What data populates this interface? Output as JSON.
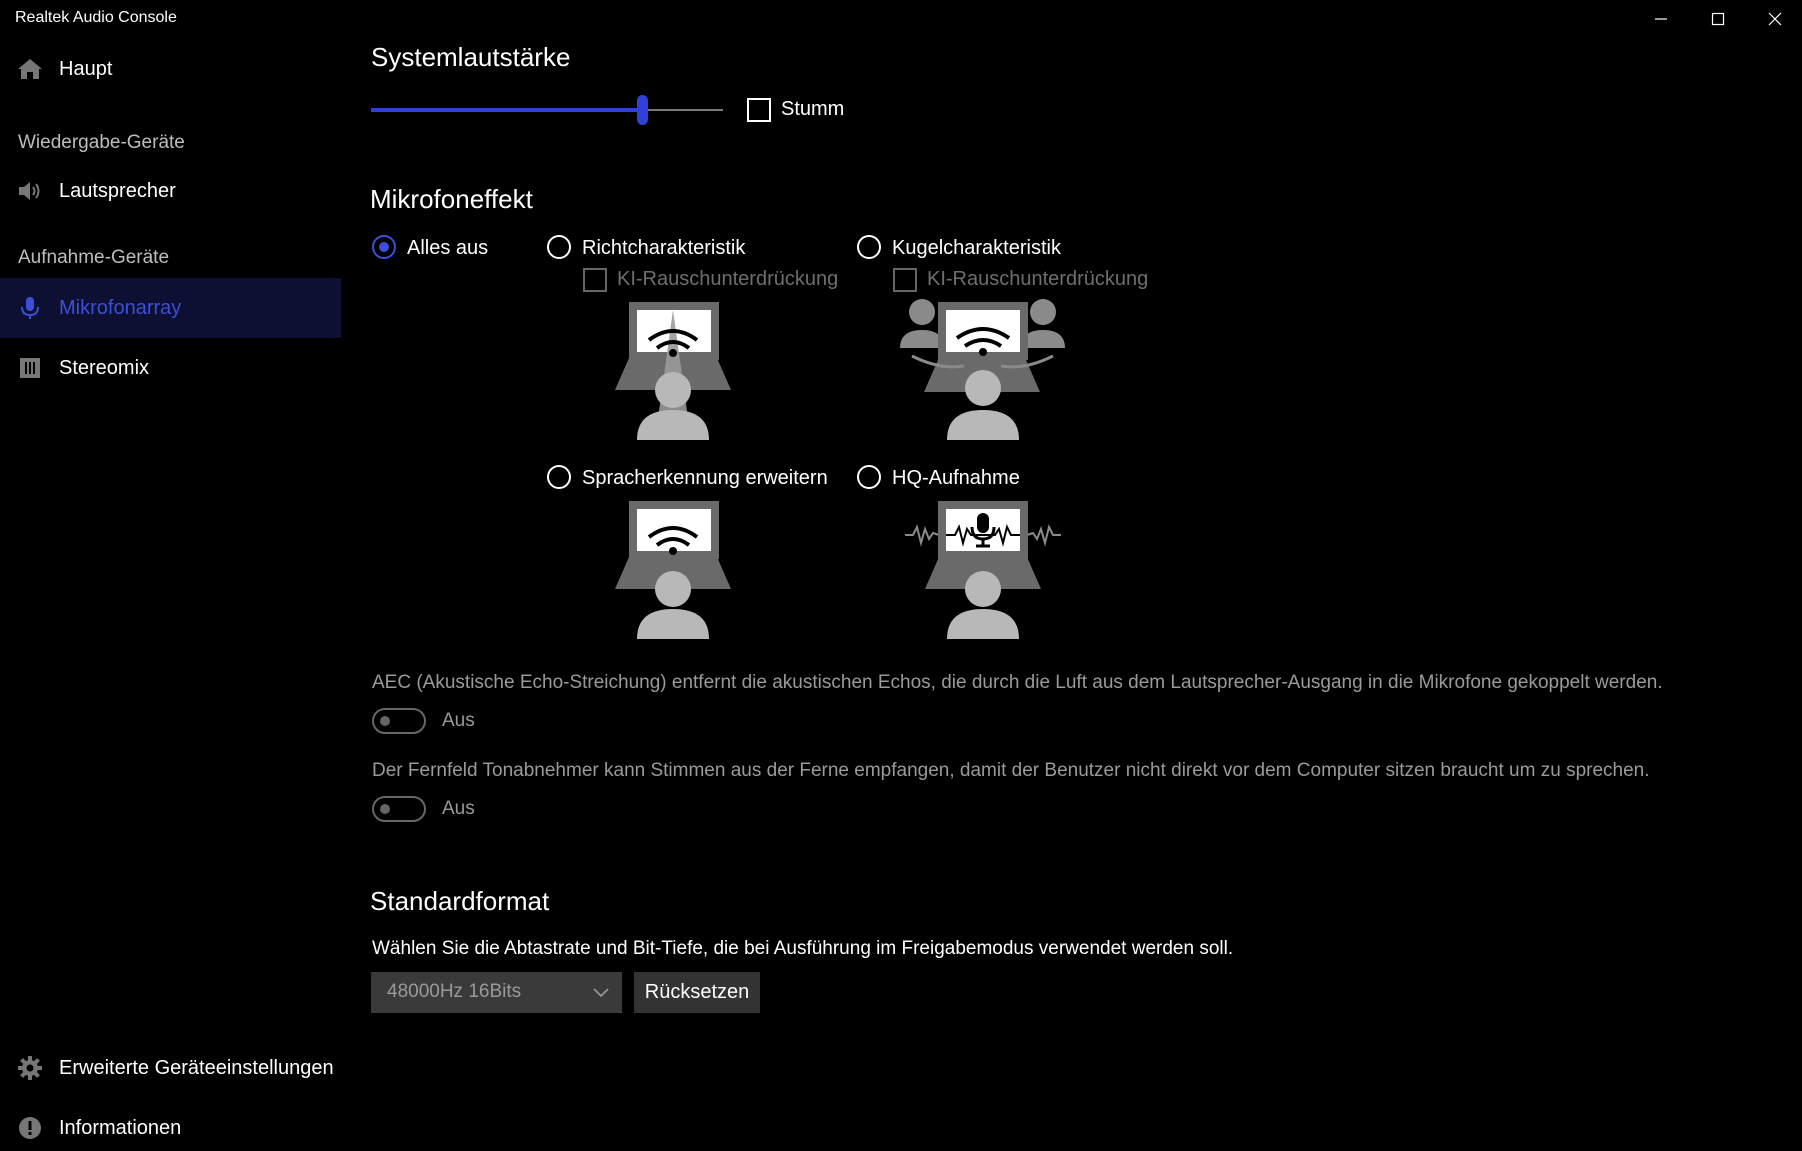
{
  "window": {
    "title": "Realtek Audio Console",
    "controls": [
      "minimize-icon",
      "maximize-icon",
      "close-icon"
    ]
  },
  "sidebar": {
    "home": {
      "label": "Haupt",
      "icon": "home-icon"
    },
    "playback_header": "Wiedergabe-Geräte",
    "playback_items": [
      {
        "label": "Lautsprecher",
        "icon": "speaker-icon"
      }
    ],
    "recording_header": "Aufnahme-Geräte",
    "recording_items": [
      {
        "label": "Mikrofonarray",
        "icon": "microphone-icon",
        "active": true
      },
      {
        "label": "Stereomix",
        "icon": "stereomix-icon"
      }
    ],
    "footer_items": [
      {
        "label": "Erweiterte Geräteeinstellungen",
        "icon": "gear-icon"
      },
      {
        "label": "Informationen",
        "icon": "info-icon"
      }
    ]
  },
  "volume": {
    "title": "Systemlautstärke",
    "level": 0.77,
    "mute_label": "Stumm",
    "muted": false
  },
  "mic_effect": {
    "title": "Mikrofoneffekt",
    "options": [
      {
        "label": "Alles aus",
        "selected": true
      },
      {
        "label": "Richtcharakteristik",
        "selected": false,
        "sub_checkbox": "KI-Rauschunterdrückung"
      },
      {
        "label": "Kugelcharakteristik",
        "selected": false,
        "sub_checkbox": "KI-Rauschunterdrückung"
      },
      {
        "label": "Spracherkennung erweitern",
        "selected": false
      },
      {
        "label": "HQ-Aufnahme",
        "selected": false
      }
    ]
  },
  "aec": {
    "description": "AEC (Akustische Echo-Streichung) entfernt die akustischen Echos, die durch die Luft aus dem Lautsprecher-Ausgang in die Mikrofone gekoppelt werden.",
    "toggle_label": "Aus"
  },
  "farfield": {
    "description": "Der Fernfeld Tonabnehmer kann Stimmen aus der Ferne empfangen, damit der Benutzer nicht direkt vor dem Computer sitzen braucht um zu sprechen.",
    "toggle_label": "Aus"
  },
  "default_format": {
    "title": "Standardformat",
    "description": "Wählen Sie die Abtastrate und Bit-Tiefe, die bei Ausführung im Freigabemodus verwendet werden soll.",
    "selected_format": "48000Hz 16Bits",
    "reset_label": "Rücksetzen"
  },
  "colors": {
    "accent": "#3c4fd6",
    "active_nav_bg": "#0d1033",
    "background": "#000000"
  }
}
